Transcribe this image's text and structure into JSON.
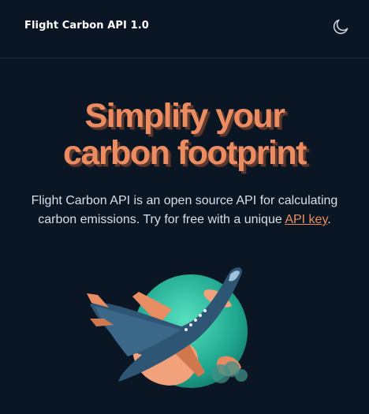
{
  "header": {
    "app_title": "Flight Carbon API 1.0",
    "theme_toggle_icon": "moon-icon"
  },
  "hero": {
    "title_line1": "Simplify your",
    "title_line2": "carbon footprint",
    "description_prefix": "Flight Carbon API is an open source API for calculating carbon emissions. Try for free with a unique ",
    "link_label": "API key",
    "description_suffix": ".",
    "illustration_icon": "airplane-globe-illustration"
  },
  "colors": {
    "background": "#0b1624",
    "accent": "#ee8c61",
    "text": "#d9dfe7",
    "globe_teal": "#2bb59a",
    "airplane_blue": "#2a4c66"
  }
}
